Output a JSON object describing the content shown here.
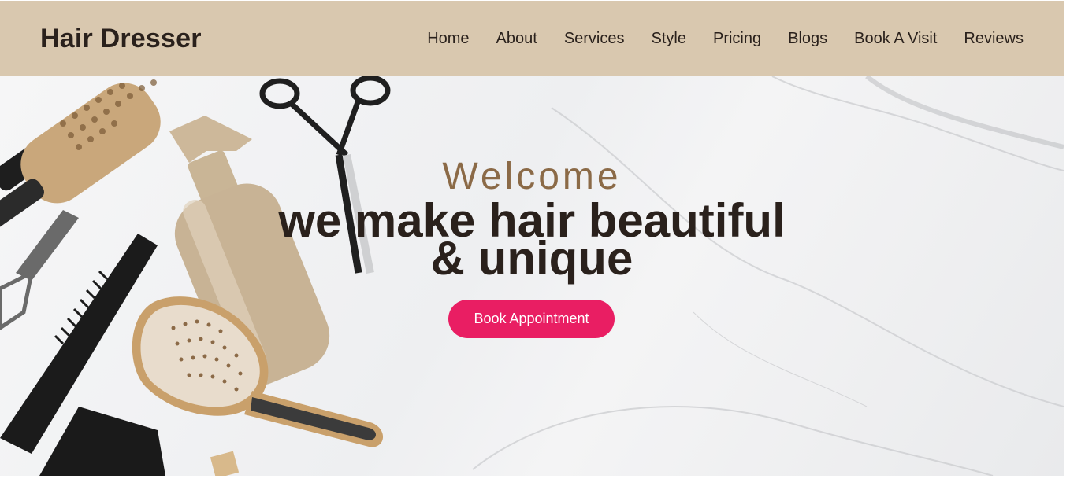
{
  "header": {
    "brand": "Hair Dresser",
    "nav": [
      "Home",
      "About",
      "Services",
      "Style",
      "Pricing",
      "Blogs",
      "Book A Visit",
      "Reviews"
    ]
  },
  "hero": {
    "welcome": "Welcome",
    "headline_line1": "we make hair beautiful",
    "headline_line2": "& unique",
    "cta_label": "Book Appointment"
  },
  "colors": {
    "header_bg": "#d9c8af",
    "text_dark": "#2a211c",
    "accent_welcome": "#8b6a47",
    "cta_bg": "#e91e63"
  },
  "icons": [
    "round-brush-icon",
    "scissors-icon",
    "spray-bottle-icon",
    "comb-icon",
    "paddle-brush-icon"
  ]
}
